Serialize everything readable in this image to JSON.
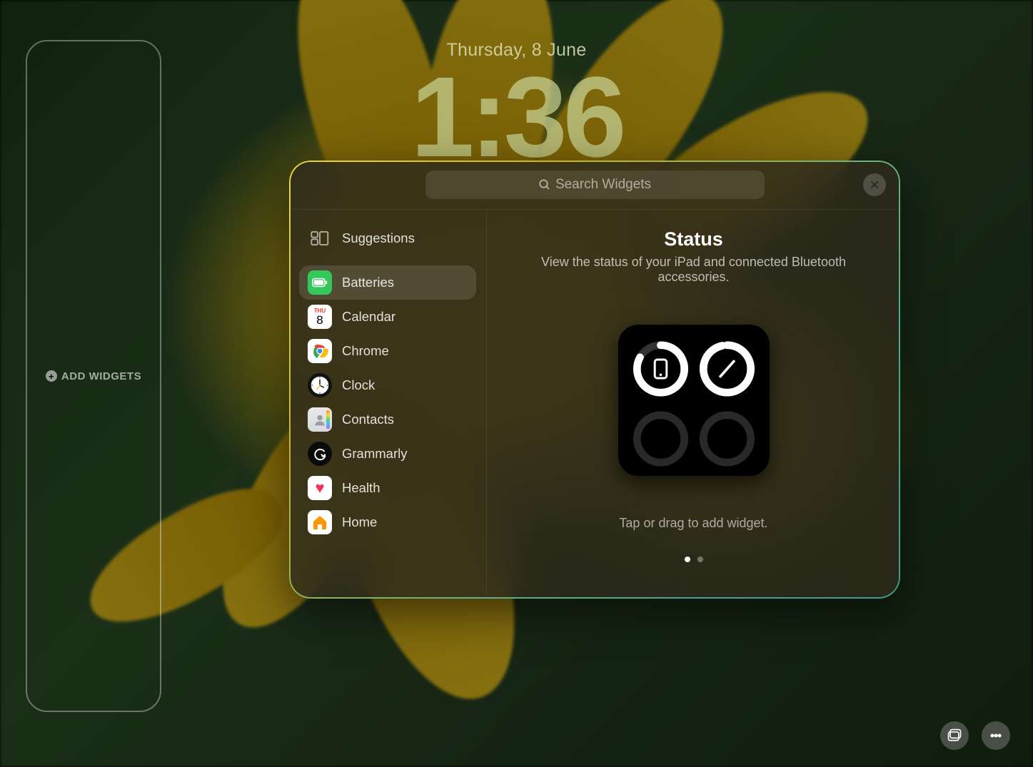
{
  "lockscreen": {
    "date": "Thursday, 8 June",
    "time": "1:36",
    "add_widgets_label": "ADD WIDGETS"
  },
  "panel": {
    "search_placeholder": "Search Widgets",
    "sidebar": {
      "suggestions_label": "Suggestions",
      "items": [
        {
          "label": "Batteries",
          "selected": true
        },
        {
          "label": "Calendar"
        },
        {
          "label": "Chrome"
        },
        {
          "label": "Clock"
        },
        {
          "label": "Contacts"
        },
        {
          "label": "Grammarly"
        },
        {
          "label": "Health"
        },
        {
          "label": "Home"
        }
      ],
      "calendar_icon": {
        "weekday": "THU",
        "day": "8"
      }
    },
    "detail": {
      "title": "Status",
      "description": "View the status of your iPad and connected Bluetooth accessories.",
      "hint": "Tap or drag to add widget.",
      "page_count": 2,
      "active_page": 0
    }
  }
}
